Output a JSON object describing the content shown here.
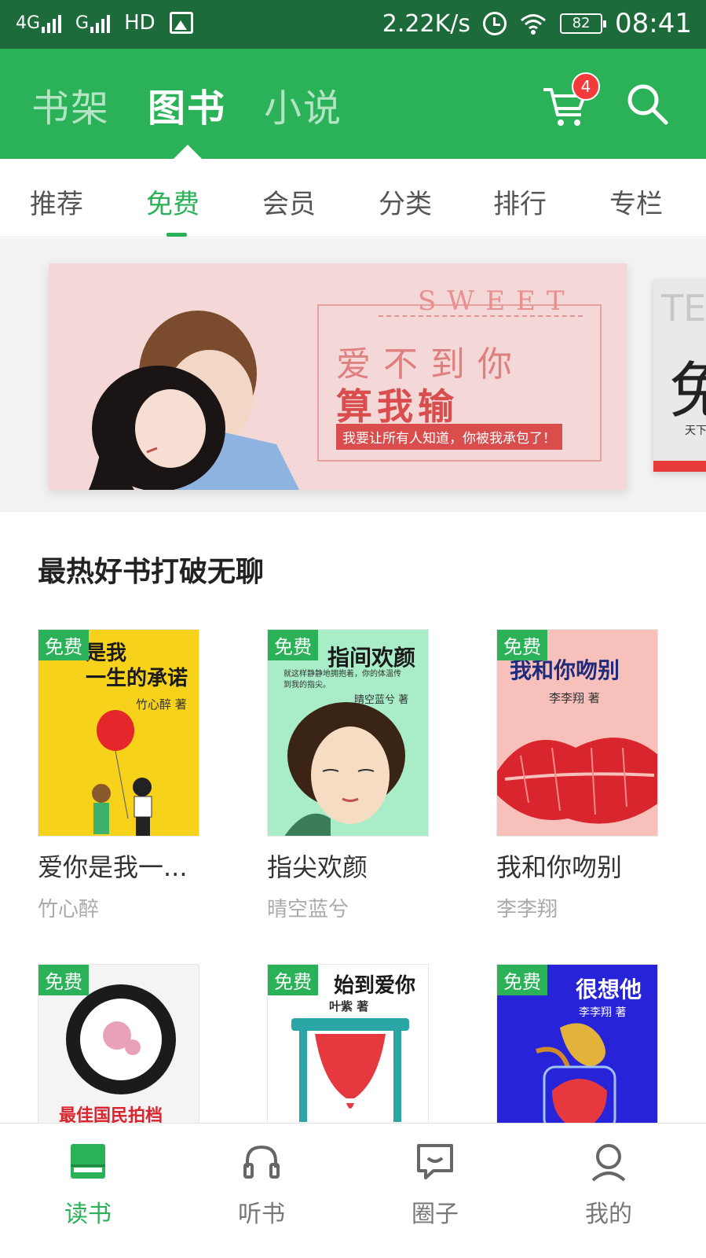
{
  "status_bar": {
    "net1": "4G",
    "net2": "G",
    "hd": "HD",
    "speed": "2.22K/s",
    "battery": "82",
    "time": "08:41"
  },
  "header": {
    "tabs": [
      {
        "label": "书架"
      },
      {
        "label": "图书",
        "active": true
      },
      {
        "label": "小说"
      }
    ],
    "cart_badge": "4",
    "icons": [
      "cart-icon",
      "search-icon"
    ]
  },
  "subtabs": [
    {
      "label": "推荐"
    },
    {
      "label": "免费",
      "active": true
    },
    {
      "label": "会员"
    },
    {
      "label": "分类"
    },
    {
      "label": "排行"
    },
    {
      "label": "专栏"
    }
  ],
  "banner": {
    "sweet": "SWEET",
    "line1": "爱不到你",
    "line2": "算我输",
    "tagline": "我要让所有人知道，你被我承包了！",
    "next_big": "TE",
    "next_glyph": "免",
    "next_small": "天下"
  },
  "section": {
    "title": "最热好书打破无聊"
  },
  "books": [
    {
      "free": "免费",
      "title": "爱你是我一...",
      "author": "竹心醉",
      "cover_title": "是我\n一生的承诺",
      "cover_author": "竹心醉 著",
      "bg": "#f6d21a"
    },
    {
      "free": "免费",
      "title": "指尖欢颜",
      "author": "晴空蓝兮",
      "cover_title": "指间欢颜",
      "cover_author": "晴空蓝兮 著",
      "cover_sub": "就这样静静地拥抱着，你的体温传到我的指尖。",
      "bg": "#a9ecc8"
    },
    {
      "free": "免费",
      "title": "我和你吻别",
      "author": "李李翔",
      "cover_title": "我和你吻别",
      "cover_author": "李李翔 著",
      "bg": "#f8c0bb"
    },
    {
      "free": "免费",
      "title": "",
      "author": "",
      "cover_title": "最佳国民拍档",
      "cover_author": "",
      "bg": "#f4f4f4"
    },
    {
      "free": "免费",
      "title": "",
      "author": "",
      "cover_title": "始到爱你",
      "cover_author": "叶紫 著",
      "bg": "#ffffff"
    },
    {
      "free": "免费",
      "title": "",
      "author": "",
      "cover_title": "很想他",
      "cover_author": "李李翔 著",
      "bg": "#2723d8"
    }
  ],
  "bottom_nav": [
    {
      "label": "读书",
      "icon": "book-icon",
      "active": true
    },
    {
      "label": "听书",
      "icon": "headphones-icon"
    },
    {
      "label": "圈子",
      "icon": "chat-icon"
    },
    {
      "label": "我的",
      "icon": "profile-icon"
    }
  ],
  "colors": {
    "primary": "#2bb157",
    "status_bar": "#1d6a3a",
    "badge": "#f43b3b"
  }
}
